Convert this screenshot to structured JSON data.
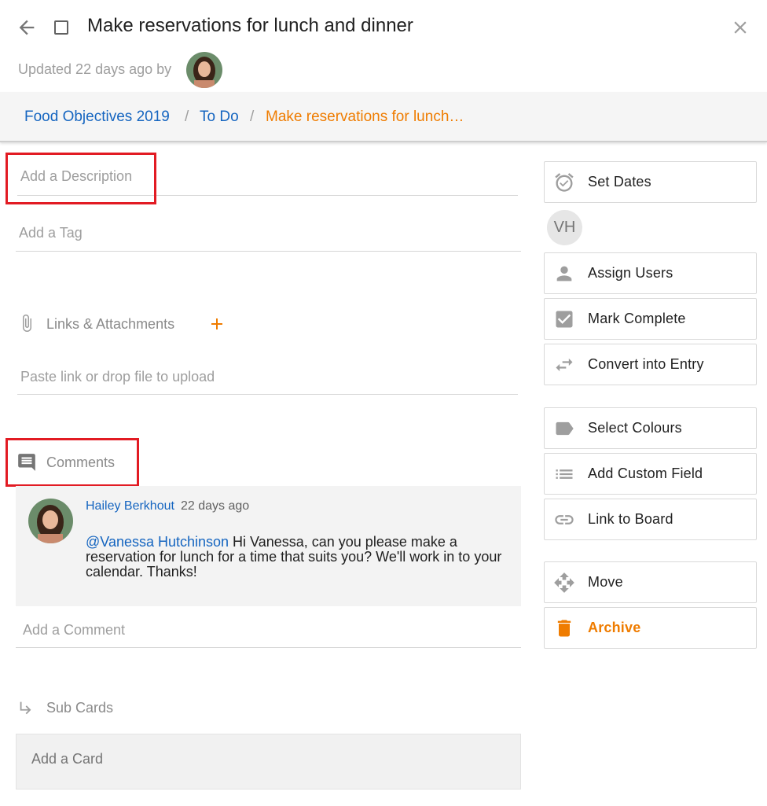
{
  "header": {
    "title": "Make reservations for lunch and dinner",
    "updated_text": "Updated 22 days ago by"
  },
  "breadcrumb": {
    "items": [
      {
        "label": "Food Objectives 2019"
      },
      {
        "label": "To Do"
      },
      {
        "label": "Make reservations for lunch…"
      }
    ],
    "separator": "/"
  },
  "fields": {
    "description_placeholder": "Add a Description",
    "tag_placeholder": "Add a Tag",
    "attachments_label": "Links & Attachments",
    "attachments_placeholder": "Paste link or drop file to upload",
    "comments_label": "Comments",
    "comment_placeholder": "Add a Comment",
    "subcards_label": "Sub Cards",
    "add_card_placeholder": "Add a Card"
  },
  "comment": {
    "author": "Hailey Berkhout",
    "time": "22 days ago",
    "mention": "@Vanessa Hutchinson",
    "text": " Hi Vanessa, can you please make a reservation for lunch for a time that suits you? We'll work in to your calendar. Thanks!"
  },
  "sidebar": {
    "assignee_initials": "VH",
    "buttons": {
      "set_dates": "Set Dates",
      "assign_users": "Assign Users",
      "mark_complete": "Mark Complete",
      "convert": "Convert into Entry",
      "select_colours": "Select Colours",
      "custom_field": "Add Custom Field",
      "link_board": "Link to Board",
      "move": "Move",
      "archive": "Archive"
    }
  },
  "colors": {
    "accent_orange": "#ef7c00",
    "link_blue": "#1565c0",
    "highlight_red": "#e21b23"
  }
}
